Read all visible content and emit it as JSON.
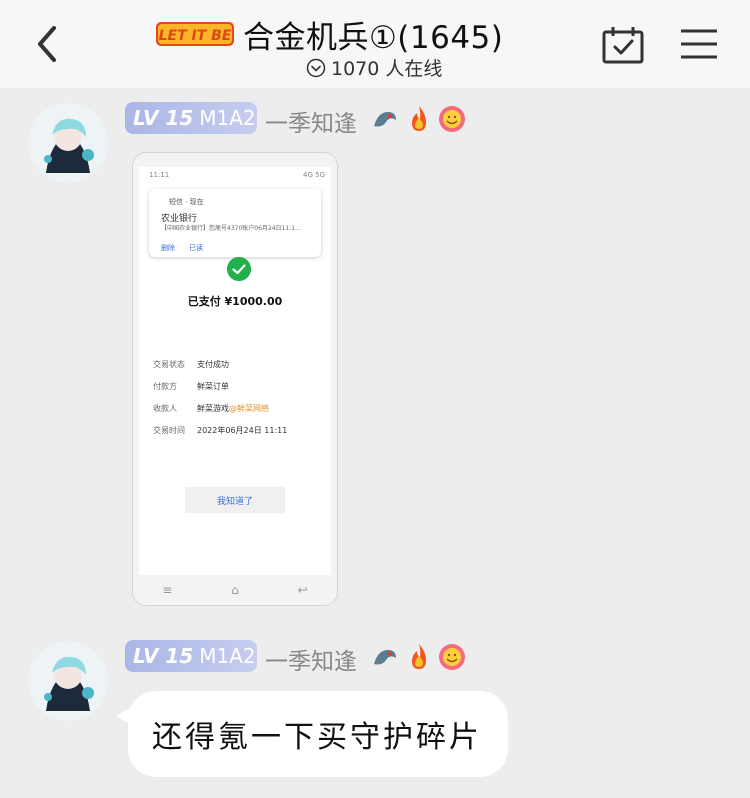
{
  "header": {
    "logo_text": "LET IT BE",
    "title": "合金机兵①(1645)",
    "online_count": "1070 人在线"
  },
  "messages": [
    {
      "level": "LV 15",
      "model": "M1A2",
      "username": "一季知逢",
      "type": "image",
      "screenshot": {
        "status_left": "11:11",
        "status_right": "4G 5G",
        "notif_app": "短信 · 现在",
        "notif_title": "农业银行",
        "notif_body": "【中国农业银行】您尾号4370账户06月24日11:1…",
        "notif_action1": "删除",
        "notif_action2": "已读",
        "paid_text": "已支付 ¥1000.00",
        "rows": [
          {
            "label": "交易状态",
            "value": "支付成功",
            "extra": ""
          },
          {
            "label": "付款方",
            "value": "鲜菜订单",
            "extra": ""
          },
          {
            "label": "收款人",
            "value": "鲜菜游戏",
            "extra": "@鲜菜网络"
          },
          {
            "label": "交易时间",
            "value": "2022年06月24日 11:11",
            "extra": ""
          }
        ],
        "ok_label": "我知道了",
        "nav": [
          "≡",
          "⌂",
          "↩"
        ]
      }
    },
    {
      "level": "LV 15",
      "model": "M1A2",
      "username": "一季知逢",
      "type": "text",
      "text": "还得氪一下买守护碎片"
    }
  ],
  "colors": {
    "header_bg": "#f7f7f7",
    "chat_bg": "#ededed",
    "badge": "#aab6e6",
    "success": "#21b04c",
    "link": "#3a6fd8"
  }
}
